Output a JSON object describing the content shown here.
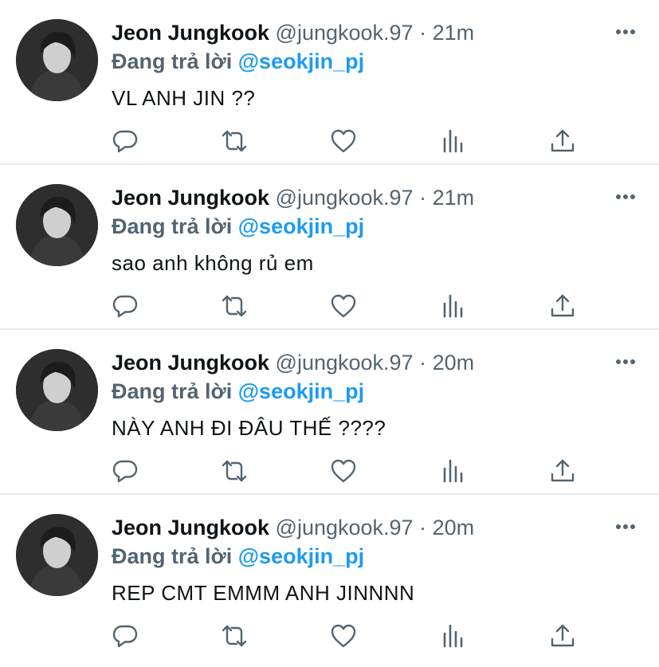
{
  "tweets": [
    {
      "name": "Jeon Jungkook",
      "handle": "@jungkook.97",
      "separator": "·",
      "time": "21m",
      "reply_prefix": "Đang trả lời",
      "reply_to": "@seokjin_pj",
      "text": "VL ANH JIN ??"
    },
    {
      "name": "Jeon Jungkook",
      "handle": "@jungkook.97",
      "separator": "·",
      "time": "21m",
      "reply_prefix": "Đang trả lời",
      "reply_to": "@seokjin_pj",
      "text": "sao anh không rủ em"
    },
    {
      "name": "Jeon Jungkook",
      "handle": "@jungkook.97",
      "separator": "·",
      "time": "20m",
      "reply_prefix": "Đang trả lời",
      "reply_to": "@seokjin_pj",
      "text": "NÀY ANH ĐI ĐÂU THẾ ????"
    },
    {
      "name": "Jeon Jungkook",
      "handle": "@jungkook.97",
      "separator": "·",
      "time": "20m",
      "reply_prefix": "Đang trả lời",
      "reply_to": "@seokjin_pj",
      "text": "REP CMT EMMM ANH JINNNN"
    }
  ],
  "icons": {
    "more": "more-horizontal-icon",
    "reply": "reply-icon",
    "retweet": "retweet-icon",
    "like": "heart-icon",
    "stats": "analytics-icon",
    "share": "share-icon"
  },
  "colors": {
    "name": "#0f1419",
    "meta": "#536471",
    "link": "#1d9bf0",
    "divider": "#e7e9ea",
    "icon": "#536471"
  }
}
